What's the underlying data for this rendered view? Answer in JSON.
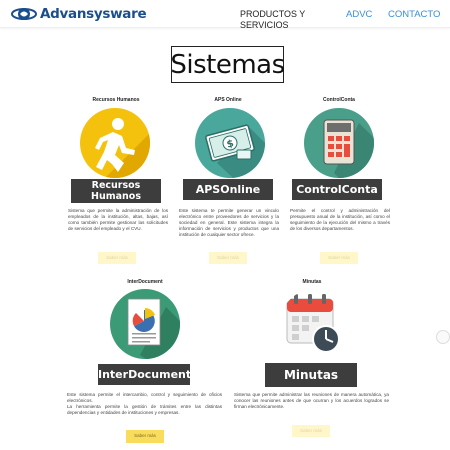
{
  "header": {
    "brand": "Advansysware",
    "nav": [
      "PRODUCTOS Y SERVICIOS",
      "ADVC",
      "CONTACTO"
    ]
  },
  "title": "Sistemas",
  "cards": [
    {
      "caption": "Recursos Humanos",
      "label_line1": "Recursos",
      "label_line2": "Humanos",
      "description": "Sistema que permite la administración de los empleados de la institución, altas, bajas, así como también permite gestionar las solicitudes de servicios del empleado y el CVU.",
      "button": "Saber más",
      "icon": "running-person-icon",
      "color": "#f4c20d"
    },
    {
      "caption": "APS Online",
      "label": "APSOnline",
      "description": "Este sistema te permite generar un vinculo electrónico entre proveedores de servicios y la sociedad en general. Este sistema integra la información de servicios y productos que una institución de cualquier sector ofrece.",
      "button": "Saber más",
      "icon": "money-bill-icon",
      "color": "#4aa79b"
    },
    {
      "caption": "ControlConta",
      "label": "ControlConta",
      "description": "Permite el control y administración del presupuesto anual de la institución, así como el seguimiento de la ejecución del mismo a través de los diversos departamentos.",
      "button": "Saber más",
      "icon": "calculator-icon",
      "color": "#4a9f8a"
    },
    {
      "caption": "InterDocument",
      "label": "InterDocument",
      "description_p1": "Este sistema permite el intercambio, control y seguimiento de oficios electrónicos.",
      "description_p2": "La herramienta permite la gestión de trámites entre las distintas dependencias y entidades de instituciones y empresas.",
      "button": "Saber más",
      "icon": "document-chart-icon",
      "color": "#3c9b77"
    },
    {
      "caption": "Minutas",
      "label": "Minutas",
      "description": "Sistema que permite administrar las reuniones de manera automática, ya conocer las reuniones antes de que ocurran y los acuerdos logrados se firman electrónicamente.",
      "button": "Saber más",
      "icon": "calendar-clock-icon",
      "color": "#e94b3c"
    }
  ]
}
